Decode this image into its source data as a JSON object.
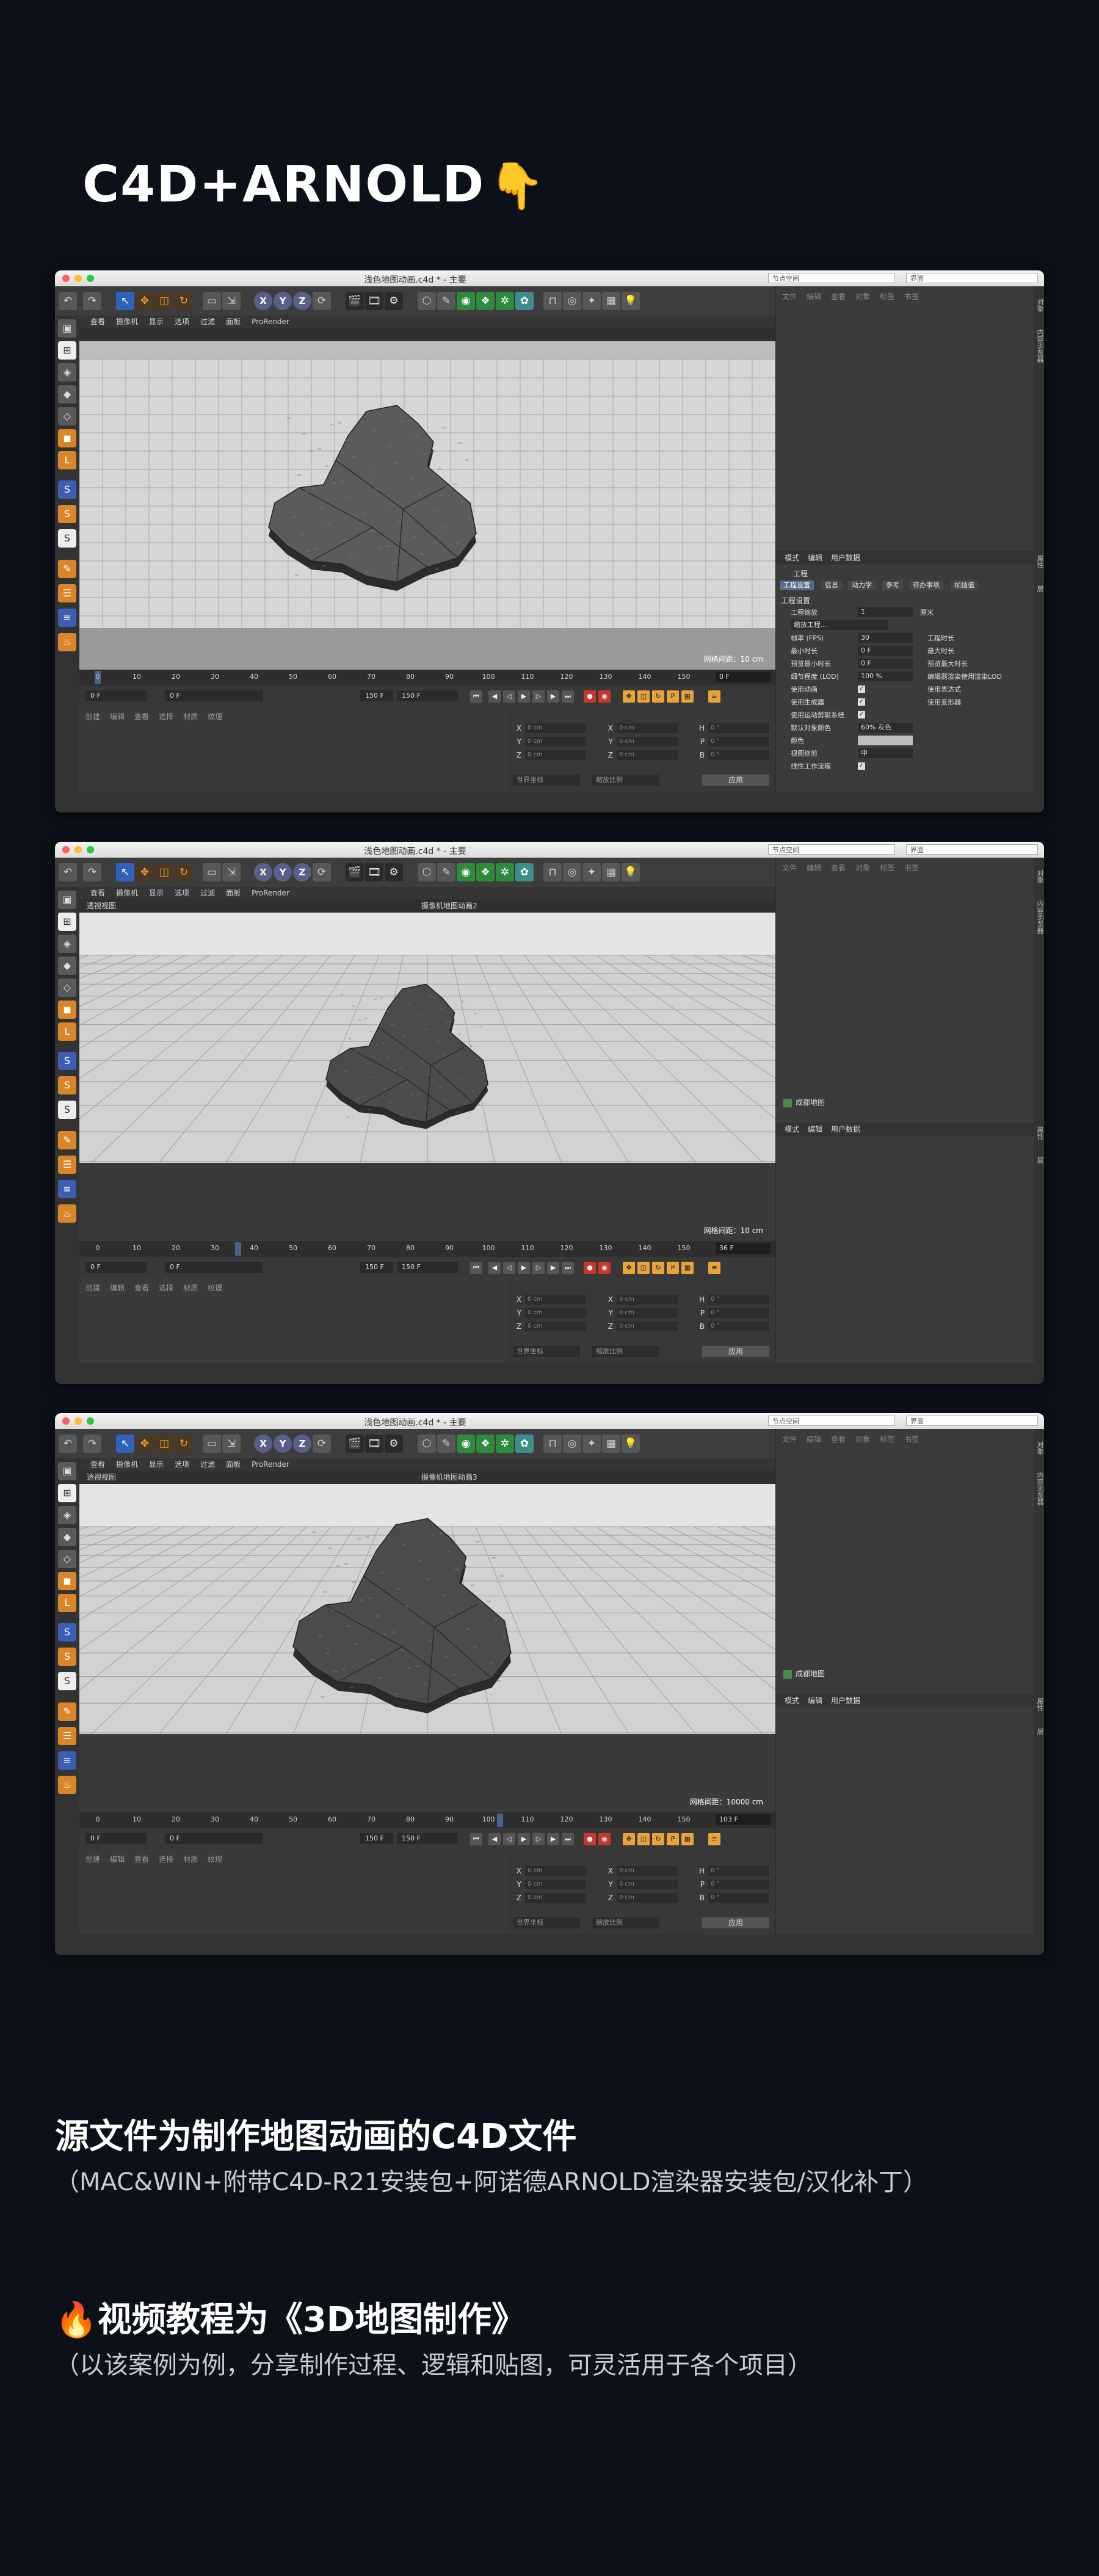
{
  "hero": {
    "title": "C4D+ARNOLD",
    "icon": "pointing-down-hand-icon"
  },
  "app": {
    "header_node_space": "节点空间",
    "header_interface": "界面",
    "viewport_menu": [
      "查看",
      "摄像机",
      "显示",
      "选项",
      "过滤",
      "面板",
      "ProRender"
    ],
    "timeline_ticks": [
      "0",
      "10",
      "20",
      "30",
      "40",
      "50",
      "60",
      "70",
      "80",
      "90",
      "100",
      "110",
      "120",
      "130",
      "140",
      "150"
    ],
    "transport_fields": [
      "0 F",
      "0 F",
      "150 F",
      "150 F"
    ],
    "bottom_menu": [
      "创建",
      "编辑",
      "查看",
      "选择",
      "材质",
      "纹理"
    ],
    "coord_axes": [
      "X",
      "Y",
      "Z"
    ],
    "coord_pos": [
      "0 cm",
      "0 cm",
      "0 cm"
    ],
    "coord_size": [
      "0 cm",
      "0 cm",
      "0 cm"
    ],
    "coord_rot_labels": [
      "H",
      "P",
      "B"
    ],
    "coord_rot": [
      "0 °",
      "0 °",
      "0 °"
    ],
    "coord_dd1": "世界坐标",
    "coord_dd2": "缩放比例",
    "apply": "应用",
    "om_menu": [
      "文件",
      "编辑",
      "查看",
      "对象",
      "标签",
      "书签"
    ],
    "attr_menu": [
      "模式",
      "编辑",
      "用户数据"
    ],
    "side_tab_1": "对象",
    "side_tab_2": "内容浏览器",
    "side_tab_3": "属性",
    "side_tab_4": "层"
  },
  "windows": [
    {
      "title": "浅色地图动画.c4d * - 主要",
      "viewport_label": "",
      "camera_label": "",
      "grid_readout": "网格间距：10 cm",
      "frame": "0 F",
      "playhead": 0,
      "show_attr_details": true,
      "object_item": ""
    },
    {
      "title": "浅色地图动画.c4d * - 主要",
      "viewport_label": "透视视图",
      "camera_label": "摄像机地图动画2",
      "grid_readout": "网格间距：10 cm",
      "frame": "36 F",
      "playhead": 36,
      "show_attr_details": false,
      "object_item": "成都地图"
    },
    {
      "title": "浅色地图动画.c4d * - 主要",
      "viewport_label": "透视视图",
      "camera_label": "摄像机地图动画3",
      "grid_readout": "网格间距：10000 cm",
      "frame": "103 F",
      "playhead": 103,
      "show_attr_details": false,
      "object_item": "成都地图"
    }
  ],
  "attr": {
    "title": "工程",
    "tabs": [
      "工程设置",
      "信息",
      "动力学",
      "参考",
      "待办事项",
      "帧插值"
    ],
    "section": "工程设置",
    "rows": [
      {
        "label": "工程缩放",
        "value": "1",
        "extra": "厘米"
      },
      {
        "label": "",
        "value": "缩放工程...",
        "extra": ""
      },
      {
        "label": "帧率 (FPS)",
        "value": "30",
        "extra": "工程时长"
      },
      {
        "label": "最小时长",
        "value": "0 F",
        "extra": "最大时长"
      },
      {
        "label": "预览最小时长",
        "value": "0 F",
        "extra": "预览最大时长"
      },
      {
        "label": "细节程度 (LOD)",
        "value": "100 %",
        "extra": "编辑器渲染使用渲染LOD"
      },
      {
        "label": "使用动画",
        "value": "✓",
        "extra": "使用表达式"
      },
      {
        "label": "使用生成器",
        "value": "✓",
        "extra": "使用变形器"
      },
      {
        "label": "使用运动剪辑系统",
        "value": "✓",
        "extra": ""
      },
      {
        "label": "默认对象颜色",
        "value": "60% 灰色",
        "extra": ""
      },
      {
        "label": "颜色",
        "value": "",
        "extra": ""
      },
      {
        "label": "视图修剪",
        "value": "中",
        "extra": ""
      },
      {
        "label": "线性工作流程",
        "value": "✓",
        "extra": ""
      }
    ]
  },
  "captions": {
    "line1_title": "源文件为制作地图动画的C4D文件",
    "line1_sub": "（MAC&WIN+附带C4D-R21安装包+阿诺德ARNOLD渲染器安装包/汉化补丁）",
    "line2_icon": "fire-icon",
    "line2_title": "视频教程为《3D地图制作》",
    "line2_sub": "（以该案例为例，分享制作过程、逻辑和贴图，可灵活用于各个项目）"
  },
  "colors": {
    "page_bg": "#0c1018",
    "window_bg": "#3a3a3a",
    "accent_orange": "#e8a33a",
    "accent_blue": "#2f62b8"
  }
}
